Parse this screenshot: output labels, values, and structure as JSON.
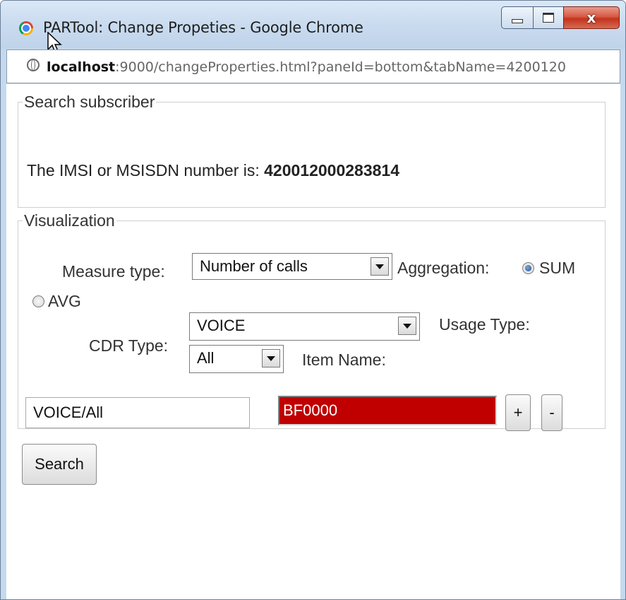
{
  "window": {
    "title": "PARTool: Change Propeties - Google Chrome",
    "controls": {
      "minimize": "minimize",
      "maximize": "maximize",
      "close": "x"
    }
  },
  "address": {
    "host": "localhost",
    "rest": ":9000/changeProperties.html?paneId=bottom&tabName=4200120"
  },
  "search_subscriber": {
    "legend": "Search subscriber",
    "imsi_label": "The IMSI or MSISDN number is: ",
    "imsi_value": "420012000283814"
  },
  "visualization": {
    "legend": "Visualization",
    "measure_type_label": "Measure type:",
    "measure_type_value": "Number of calls",
    "aggregation_label": "Aggregation:",
    "aggregation_options": [
      {
        "label": "SUM",
        "checked": true
      },
      {
        "label": "AVG",
        "checked": false
      }
    ],
    "cdr_type_label": "CDR Type:",
    "cdr_type_value": "VOICE",
    "usage_type_label": "Usage Type:",
    "usage_type_value": "All",
    "item_name_label": "Item Name:",
    "item_name_value": "VOICE/All",
    "color_value": "BF0000",
    "add_label": "+",
    "remove_label": "-"
  },
  "search_button": "Search",
  "colors": {
    "swatch": "#c00000",
    "titlebar": "#c9dbef"
  }
}
